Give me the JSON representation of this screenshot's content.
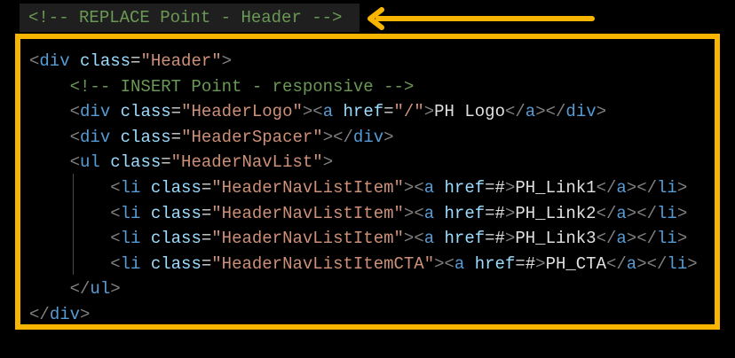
{
  "header_comment": "<!-- REPLACE Point - Header -->",
  "colors": {
    "accent": "#f7b500",
    "comment": "#6a9955",
    "tag": "#569cd6",
    "attr": "#9cdcfe",
    "string": "#ce9178",
    "bracket": "#808080"
  },
  "code_lines": [
    {
      "indent": 0,
      "tokens": [
        [
          "bracket",
          "<"
        ],
        [
          "tag",
          "div"
        ],
        [
          "text",
          " "
        ],
        [
          "attr",
          "class"
        ],
        [
          "eq",
          "="
        ],
        [
          "str",
          "\"Header\""
        ],
        [
          "bracket",
          ">"
        ]
      ]
    },
    {
      "indent": 1,
      "tokens": [
        [
          "comment",
          "<!-- INSERT Point - responsive -->"
        ]
      ]
    },
    {
      "indent": 1,
      "tokens": [
        [
          "bracket",
          "<"
        ],
        [
          "tag",
          "div"
        ],
        [
          "text",
          " "
        ],
        [
          "attr",
          "class"
        ],
        [
          "eq",
          "="
        ],
        [
          "str",
          "\"HeaderLogo\""
        ],
        [
          "bracket",
          ">"
        ],
        [
          "bracket",
          "<"
        ],
        [
          "tag",
          "a"
        ],
        [
          "text",
          " "
        ],
        [
          "attr",
          "href"
        ],
        [
          "eq",
          "="
        ],
        [
          "str",
          "\"/\""
        ],
        [
          "bracket",
          ">"
        ],
        [
          "text",
          "PH Logo"
        ],
        [
          "bracket",
          "</"
        ],
        [
          "tag",
          "a"
        ],
        [
          "bracket",
          ">"
        ],
        [
          "bracket",
          "</"
        ],
        [
          "tag",
          "div"
        ],
        [
          "bracket",
          ">"
        ]
      ]
    },
    {
      "indent": 1,
      "tokens": [
        [
          "bracket",
          "<"
        ],
        [
          "tag",
          "div"
        ],
        [
          "text",
          " "
        ],
        [
          "attr",
          "class"
        ],
        [
          "eq",
          "="
        ],
        [
          "str",
          "\"HeaderSpacer\""
        ],
        [
          "bracket",
          ">"
        ],
        [
          "bracket",
          "</"
        ],
        [
          "tag",
          "div"
        ],
        [
          "bracket",
          ">"
        ]
      ]
    },
    {
      "indent": 1,
      "tokens": [
        [
          "bracket",
          "<"
        ],
        [
          "tag",
          "ul"
        ],
        [
          "text",
          " "
        ],
        [
          "attr",
          "class"
        ],
        [
          "eq",
          "="
        ],
        [
          "str",
          "\"HeaderNavList\""
        ],
        [
          "bracket",
          ">"
        ]
      ]
    },
    {
      "indent": 2,
      "tokens": [
        [
          "bracket",
          "<"
        ],
        [
          "tag",
          "li"
        ],
        [
          "text",
          " "
        ],
        [
          "attr",
          "class"
        ],
        [
          "eq",
          "="
        ],
        [
          "str",
          "\"HeaderNavListItem\""
        ],
        [
          "bracket",
          ">"
        ],
        [
          "bracket",
          "<"
        ],
        [
          "tag",
          "a"
        ],
        [
          "text",
          " "
        ],
        [
          "attr",
          "href"
        ],
        [
          "eq",
          "="
        ],
        [
          "text",
          "#"
        ],
        [
          "bracket",
          ">"
        ],
        [
          "text",
          "PH_Link1"
        ],
        [
          "bracket",
          "</"
        ],
        [
          "tag",
          "a"
        ],
        [
          "bracket",
          ">"
        ],
        [
          "bracket",
          "</"
        ],
        [
          "tag",
          "li"
        ],
        [
          "bracket",
          ">"
        ]
      ]
    },
    {
      "indent": 2,
      "tokens": [
        [
          "bracket",
          "<"
        ],
        [
          "tag",
          "li"
        ],
        [
          "text",
          " "
        ],
        [
          "attr",
          "class"
        ],
        [
          "eq",
          "="
        ],
        [
          "str",
          "\"HeaderNavListItem\""
        ],
        [
          "bracket",
          ">"
        ],
        [
          "bracket",
          "<"
        ],
        [
          "tag",
          "a"
        ],
        [
          "text",
          " "
        ],
        [
          "attr",
          "href"
        ],
        [
          "eq",
          "="
        ],
        [
          "text",
          "#"
        ],
        [
          "bracket",
          ">"
        ],
        [
          "text",
          "PH_Link2"
        ],
        [
          "bracket",
          "</"
        ],
        [
          "tag",
          "a"
        ],
        [
          "bracket",
          ">"
        ],
        [
          "bracket",
          "</"
        ],
        [
          "tag",
          "li"
        ],
        [
          "bracket",
          ">"
        ]
      ]
    },
    {
      "indent": 2,
      "tokens": [
        [
          "bracket",
          "<"
        ],
        [
          "tag",
          "li"
        ],
        [
          "text",
          " "
        ],
        [
          "attr",
          "class"
        ],
        [
          "eq",
          "="
        ],
        [
          "str",
          "\"HeaderNavListItem\""
        ],
        [
          "bracket",
          ">"
        ],
        [
          "bracket",
          "<"
        ],
        [
          "tag",
          "a"
        ],
        [
          "text",
          " "
        ],
        [
          "attr",
          "href"
        ],
        [
          "eq",
          "="
        ],
        [
          "text",
          "#"
        ],
        [
          "bracket",
          ">"
        ],
        [
          "text",
          "PH_Link3"
        ],
        [
          "bracket",
          "</"
        ],
        [
          "tag",
          "a"
        ],
        [
          "bracket",
          ">"
        ],
        [
          "bracket",
          "</"
        ],
        [
          "tag",
          "li"
        ],
        [
          "bracket",
          ">"
        ]
      ]
    },
    {
      "indent": 2,
      "tokens": [
        [
          "bracket",
          "<"
        ],
        [
          "tag",
          "li"
        ],
        [
          "text",
          " "
        ],
        [
          "attr",
          "class"
        ],
        [
          "eq",
          "="
        ],
        [
          "str",
          "\"HeaderNavListItemCTA\""
        ],
        [
          "bracket",
          ">"
        ],
        [
          "bracket",
          "<"
        ],
        [
          "tag",
          "a"
        ],
        [
          "text",
          " "
        ],
        [
          "attr",
          "href"
        ],
        [
          "eq",
          "="
        ],
        [
          "text",
          "#"
        ],
        [
          "bracket",
          ">"
        ],
        [
          "text",
          "PH_CTA"
        ],
        [
          "bracket",
          "</"
        ],
        [
          "tag",
          "a"
        ],
        [
          "bracket",
          ">"
        ],
        [
          "bracket",
          "</"
        ],
        [
          "tag",
          "li"
        ],
        [
          "bracket",
          ">"
        ]
      ]
    },
    {
      "indent": 1,
      "tokens": [
        [
          "bracket",
          "</"
        ],
        [
          "tag",
          "ul"
        ],
        [
          "bracket",
          ">"
        ]
      ]
    },
    {
      "indent": 0,
      "tokens": [
        [
          "bracket",
          "</"
        ],
        [
          "tag",
          "div"
        ],
        [
          "bracket",
          ">"
        ]
      ]
    }
  ]
}
